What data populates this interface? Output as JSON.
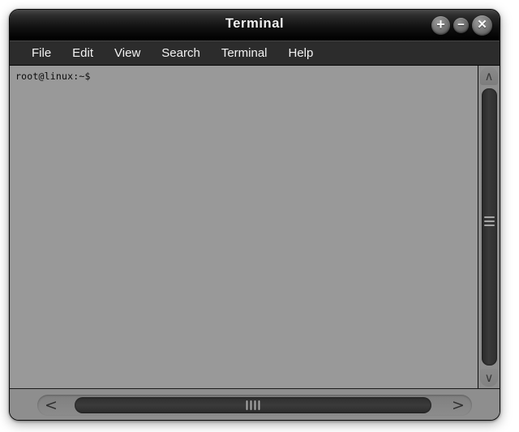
{
  "window": {
    "title": "Terminal",
    "buttons": [
      {
        "name": "maximize",
        "glyph": "+"
      },
      {
        "name": "minimize",
        "glyph": "−"
      },
      {
        "name": "close",
        "glyph": "✕"
      }
    ]
  },
  "menubar": {
    "items": [
      {
        "label": "File"
      },
      {
        "label": "Edit"
      },
      {
        "label": "View"
      },
      {
        "label": "Search"
      },
      {
        "label": "Terminal"
      },
      {
        "label": "Help"
      }
    ]
  },
  "terminal": {
    "lines": [
      "root@linux:~$"
    ],
    "prompt": "root@linux:~$",
    "background_color": "#999999",
    "text_color": "#0b0b0b"
  },
  "scrollbars": {
    "vertical": {
      "up_arrow_glyph": "∧",
      "down_arrow_glyph": "∨",
      "grip_lines": 3
    },
    "horizontal": {
      "left_arrow_glyph": "<",
      "right_arrow_glyph": ">",
      "grip_lines": 4
    }
  },
  "colors": {
    "titlebar_top": "#4a4a4a",
    "titlebar_bottom": "#000000",
    "menubar": "#2c2c2c",
    "frame": "#8e8e8e",
    "screen": "#999999",
    "thumb": "#303030"
  }
}
